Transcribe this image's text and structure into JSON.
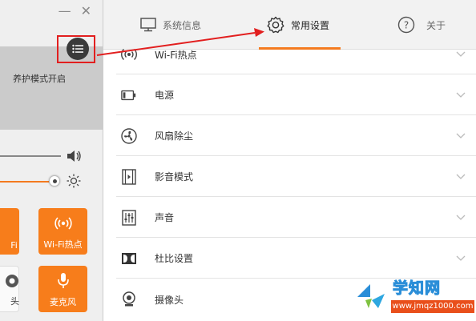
{
  "window": {
    "minimize": "—",
    "close": "✕"
  },
  "left": {
    "banner_text": "养护模式开启",
    "tiles": [
      {
        "label": "Fi"
      },
      {
        "label": "Wi-Fi热点"
      },
      {
        "label": "头"
      },
      {
        "label": "麦克风"
      }
    ],
    "volume_level": 1.0,
    "brightness_level": 1.0
  },
  "tabs": [
    {
      "label": "系统信息",
      "icon": "monitor-icon"
    },
    {
      "label": "常用设置",
      "icon": "gear-icon",
      "active": true
    },
    {
      "label": "关于",
      "icon": "help-icon"
    }
  ],
  "settings": [
    {
      "label": "Wi-Fi热点",
      "icon": "hotspot-icon"
    },
    {
      "label": "电源",
      "icon": "battery-icon"
    },
    {
      "label": "风扇除尘",
      "icon": "fan-icon"
    },
    {
      "label": "影音模式",
      "icon": "film-icon"
    },
    {
      "label": "声音",
      "icon": "equalizer-icon"
    },
    {
      "label": "杜比设置",
      "icon": "dolby-icon"
    },
    {
      "label": "摄像头",
      "icon": "camera-icon"
    }
  ],
  "watermark": {
    "title": "学知网",
    "url": "www.jmqz1000.com"
  },
  "colors": {
    "accent": "#f47a1f",
    "highlight": "#e21f1f",
    "tile": "#f77d1b"
  }
}
